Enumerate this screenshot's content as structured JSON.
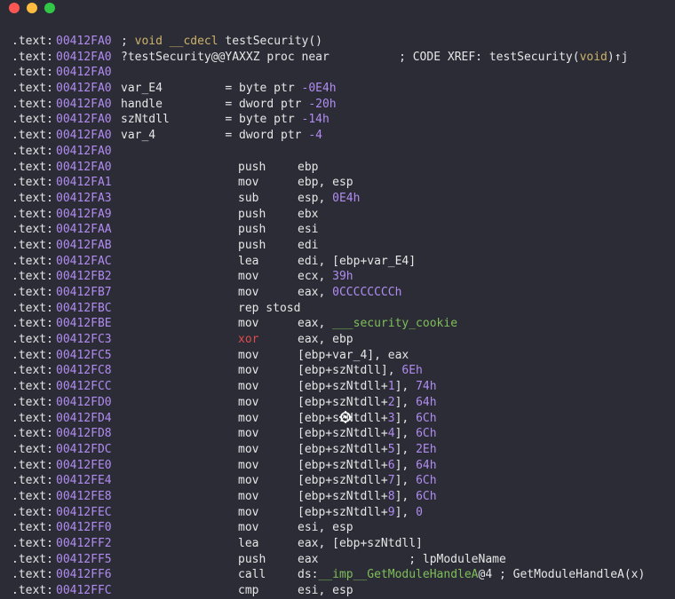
{
  "window": {
    "controls": [
      "close",
      "minimize",
      "maximize"
    ],
    "colors": {
      "close": "#fc5753",
      "minimize": "#fdbc40",
      "maximize": "#33c748"
    }
  },
  "theme": {
    "background": "#2b2c36",
    "text": "#e6e6e6",
    "address": "#b18cf0",
    "number": "#b18cf0",
    "keyword": "#cdb36a",
    "symbol": "#7fbf59",
    "highlight_mnemonic": "#e04c4c"
  },
  "listing": {
    "segment": ".text:",
    "header_lines": [
      {
        "address": "00412FA0",
        "rest": [
          {
            "t": "; ",
            "c": "white"
          },
          {
            "t": "void",
            "c": "olive"
          },
          {
            "t": " __cdecl ",
            "c": "olive"
          },
          {
            "t": "testSecurity()",
            "c": "white"
          }
        ]
      },
      {
        "address": "00412FA0",
        "rest": [
          {
            "t": "?testSecurity@@YAXXZ proc near",
            "c": "white"
          },
          {
            "t": "          ; CODE XREF: testSecurity(",
            "c": "white"
          },
          {
            "t": "void",
            "c": "olive"
          },
          {
            "t": ")↑j",
            "c": "white"
          }
        ]
      },
      {
        "address": "00412FA0",
        "rest": []
      },
      {
        "address": "00412FA0",
        "rest": [
          {
            "t": "var_E4         = byte ptr ",
            "c": "white"
          },
          {
            "t": "-0E4h",
            "c": "purple"
          }
        ]
      },
      {
        "address": "00412FA0",
        "rest": [
          {
            "t": "handle         = dword ptr ",
            "c": "white"
          },
          {
            "t": "-20h",
            "c": "purple"
          }
        ]
      },
      {
        "address": "00412FA0",
        "rest": [
          {
            "t": "szNtdll        = byte ptr ",
            "c": "white"
          },
          {
            "t": "-14h",
            "c": "purple"
          }
        ]
      },
      {
        "address": "00412FA0",
        "rest": [
          {
            "t": "var_4          = dword ptr ",
            "c": "white"
          },
          {
            "t": "-4",
            "c": "purple"
          }
        ]
      },
      {
        "address": "00412FA0",
        "rest": []
      }
    ],
    "instructions": [
      {
        "address": "00412FA0",
        "mnemonic": "push",
        "operands": [
          {
            "t": "ebp",
            "c": "white"
          }
        ]
      },
      {
        "address": "00412FA1",
        "mnemonic": "mov",
        "operands": [
          {
            "t": "ebp, esp",
            "c": "white"
          }
        ]
      },
      {
        "address": "00412FA3",
        "mnemonic": "sub",
        "operands": [
          {
            "t": "esp, ",
            "c": "white"
          },
          {
            "t": "0E4h",
            "c": "purple"
          }
        ]
      },
      {
        "address": "00412FA9",
        "mnemonic": "push",
        "operands": [
          {
            "t": "ebx",
            "c": "white"
          }
        ]
      },
      {
        "address": "00412FAA",
        "mnemonic": "push",
        "operands": [
          {
            "t": "esi",
            "c": "white"
          }
        ]
      },
      {
        "address": "00412FAB",
        "mnemonic": "push",
        "operands": [
          {
            "t": "edi",
            "c": "white"
          }
        ]
      },
      {
        "address": "00412FAC",
        "mnemonic": "lea",
        "operands": [
          {
            "t": "edi, [ebp+var_E4]",
            "c": "white"
          }
        ]
      },
      {
        "address": "00412FB2",
        "mnemonic": "mov",
        "operands": [
          {
            "t": "ecx, ",
            "c": "white"
          },
          {
            "t": "39h",
            "c": "purple"
          }
        ]
      },
      {
        "address": "00412FB7",
        "mnemonic": "mov",
        "operands": [
          {
            "t": "eax, ",
            "c": "white"
          },
          {
            "t": "0CCCCCCCCh",
            "c": "purple"
          }
        ]
      },
      {
        "address": "00412FBC",
        "mnemonic": "rep stosd",
        "operands": []
      },
      {
        "address": "00412FBE",
        "mnemonic": "mov",
        "operands": [
          {
            "t": "eax, ",
            "c": "white"
          },
          {
            "t": "___security_cookie",
            "c": "green"
          }
        ]
      },
      {
        "address": "00412FC3",
        "mnemonic": "xor",
        "mnemonic_color": "red",
        "operands": [
          {
            "t": "eax, ebp",
            "c": "white"
          }
        ]
      },
      {
        "address": "00412FC5",
        "mnemonic": "mov",
        "operands": [
          {
            "t": "[ebp+var_4], eax",
            "c": "white"
          }
        ]
      },
      {
        "address": "00412FC8",
        "mnemonic": "mov",
        "operands": [
          {
            "t": "[ebp+szNtdll], ",
            "c": "white"
          },
          {
            "t": "6Eh",
            "c": "purple"
          }
        ]
      },
      {
        "address": "00412FCC",
        "mnemonic": "mov",
        "operands": [
          {
            "t": "[ebp+szNtdll+",
            "c": "white"
          },
          {
            "t": "1",
            "c": "purple"
          },
          {
            "t": "], ",
            "c": "white"
          },
          {
            "t": "74h",
            "c": "purple"
          }
        ]
      },
      {
        "address": "00412FD0",
        "mnemonic": "mov",
        "operands": [
          {
            "t": "[ebp+szNtdll+",
            "c": "white"
          },
          {
            "t": "2",
            "c": "purple"
          },
          {
            "t": "], ",
            "c": "white"
          },
          {
            "t": "64h",
            "c": "purple"
          }
        ]
      },
      {
        "address": "00412FD4",
        "mnemonic": "mov",
        "operands": [
          {
            "t": "[ebp+szNtdll+",
            "c": "white"
          },
          {
            "t": "3",
            "c": "purple"
          },
          {
            "t": "], ",
            "c": "white"
          },
          {
            "t": "6Ch",
            "c": "purple"
          }
        ]
      },
      {
        "address": "00412FD8",
        "mnemonic": "mov",
        "operands": [
          {
            "t": "[ebp+szNtdll+",
            "c": "white"
          },
          {
            "t": "4",
            "c": "purple"
          },
          {
            "t": "], ",
            "c": "white"
          },
          {
            "t": "6Ch",
            "c": "purple"
          }
        ]
      },
      {
        "address": "00412FDC",
        "mnemonic": "mov",
        "operands": [
          {
            "t": "[ebp+szNtdll+",
            "c": "white"
          },
          {
            "t": "5",
            "c": "purple"
          },
          {
            "t": "], ",
            "c": "white"
          },
          {
            "t": "2Eh",
            "c": "purple"
          }
        ]
      },
      {
        "address": "00412FE0",
        "mnemonic": "mov",
        "operands": [
          {
            "t": "[ebp+szNtdll+",
            "c": "white"
          },
          {
            "t": "6",
            "c": "purple"
          },
          {
            "t": "], ",
            "c": "white"
          },
          {
            "t": "64h",
            "c": "purple"
          }
        ]
      },
      {
        "address": "00412FE4",
        "mnemonic": "mov",
        "operands": [
          {
            "t": "[ebp+szNtdll+",
            "c": "white"
          },
          {
            "t": "7",
            "c": "purple"
          },
          {
            "t": "], ",
            "c": "white"
          },
          {
            "t": "6Ch",
            "c": "purple"
          }
        ]
      },
      {
        "address": "00412FE8",
        "mnemonic": "mov",
        "operands": [
          {
            "t": "[ebp+szNtdll+",
            "c": "white"
          },
          {
            "t": "8",
            "c": "purple"
          },
          {
            "t": "], ",
            "c": "white"
          },
          {
            "t": "6Ch",
            "c": "purple"
          }
        ]
      },
      {
        "address": "00412FEC",
        "mnemonic": "mov",
        "operands": [
          {
            "t": "[ebp+szNtdll+",
            "c": "white"
          },
          {
            "t": "9",
            "c": "purple"
          },
          {
            "t": "], ",
            "c": "white"
          },
          {
            "t": "0",
            "c": "purple"
          }
        ]
      },
      {
        "address": "00412FF0",
        "mnemonic": "mov",
        "operands": [
          {
            "t": "esi, esp",
            "c": "white"
          }
        ]
      },
      {
        "address": "00412FF2",
        "mnemonic": "lea",
        "operands": [
          {
            "t": "eax, [ebp+szNtdll]",
            "c": "white"
          }
        ]
      },
      {
        "address": "00412FF5",
        "mnemonic": "push",
        "operands": [
          {
            "t": "eax             ; lpModuleName",
            "c": "white"
          }
        ]
      },
      {
        "address": "00412FF6",
        "mnemonic": "call",
        "operands": [
          {
            "t": "ds:",
            "c": "white"
          },
          {
            "t": "__imp__GetModuleHandleA",
            "c": "green"
          },
          {
            "t": "@4 ; GetModuleHandleA(x)",
            "c": "white"
          }
        ]
      },
      {
        "address": "00412FFC",
        "mnemonic": "cmp",
        "operands": [
          {
            "t": "esi, esp",
            "c": "white"
          }
        ]
      }
    ]
  },
  "cursor": {
    "icon": "crosshair-pointer-icon"
  }
}
